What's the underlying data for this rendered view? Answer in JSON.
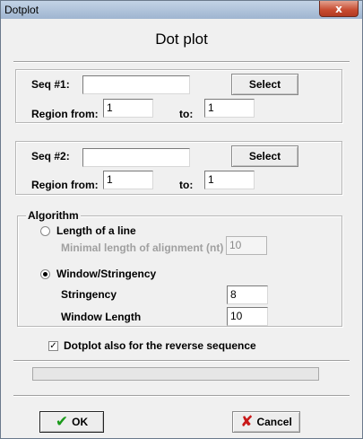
{
  "window": {
    "title": "Dotplot",
    "close_glyph": "x"
  },
  "dialog": {
    "heading": "Dot plot"
  },
  "seq1": {
    "label": "Seq #1:",
    "value": "",
    "select_label": "Select",
    "region_from_label": "Region from:",
    "region_from_value": "1",
    "to_label": "to:",
    "to_value": "1"
  },
  "seq2": {
    "label": "Seq #2:",
    "value": "",
    "select_label": "Select",
    "region_from_label": "Region from:",
    "region_from_value": "1",
    "to_label": "to:",
    "to_value": "1"
  },
  "algorithm": {
    "legend": "Algorithm",
    "length_option_label": "Length of a line",
    "length_option_checked": false,
    "min_length_label": "Minimal length of alignment (nt)",
    "min_length_value": "10",
    "window_option_label": "Window/Stringency",
    "window_option_checked": true,
    "stringency_label": "Stringency",
    "stringency_value": "8",
    "window_length_label": "Window Length",
    "window_length_value": "10"
  },
  "reverse": {
    "label": "Dotplot also for the reverse sequence",
    "checked": true,
    "check_glyph": "✓"
  },
  "progress": {
    "value": 0
  },
  "buttons": {
    "ok_label": "OK",
    "ok_icon": "✔",
    "cancel_label": "Cancel",
    "cancel_icon": "✘"
  },
  "colors": {
    "ok_icon": "#1a9a1a",
    "cancel_icon": "#c81818"
  }
}
